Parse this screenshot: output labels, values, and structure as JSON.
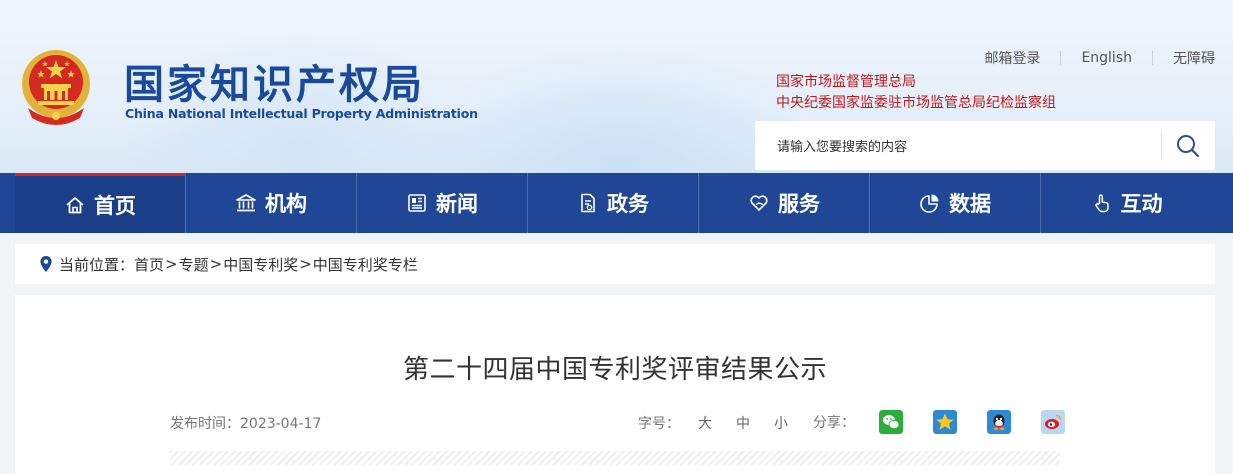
{
  "header": {
    "logo_cn": "国家知识产权局",
    "logo_en": "China National Intellectual Property Administration",
    "links": [
      "邮箱登录",
      "English",
      "无障碍"
    ],
    "org_lines": [
      "国家市场监督管理总局",
      "中央纪委国家监委驻市场监管总局纪检监察组"
    ],
    "search_placeholder": "请输入您要搜索的内容",
    "accent_red": "#d8232a",
    "brand_blue": "#1f4795"
  },
  "nav": {
    "items": [
      {
        "label": "首页",
        "icon": "home-icon"
      },
      {
        "label": "机构",
        "icon": "institution-icon"
      },
      {
        "label": "新闻",
        "icon": "newspaper-icon"
      },
      {
        "label": "政务",
        "icon": "document-icon"
      },
      {
        "label": "服务",
        "icon": "heart-hand-icon"
      },
      {
        "label": "数据",
        "icon": "pie-chart-icon"
      },
      {
        "label": "互动",
        "icon": "hand-pointer-icon"
      }
    ],
    "active_index": 0
  },
  "breadcrumb": {
    "prefix": "当前位置：",
    "items": [
      "首页",
      "专题",
      "中国专利奖",
      "中国专利奖专栏"
    ],
    "separator": ">"
  },
  "article": {
    "title": "第二十四届中国专利奖评审结果公示",
    "date_label": "发布时间：",
    "date": "2023-04-17",
    "font_size_label": "字号：",
    "font_sizes": [
      "大",
      "中",
      "小"
    ],
    "share_label": "分享：",
    "share_icons": [
      "wechat-icon",
      "qzone-icon",
      "qq-icon",
      "weibo-icon"
    ]
  }
}
